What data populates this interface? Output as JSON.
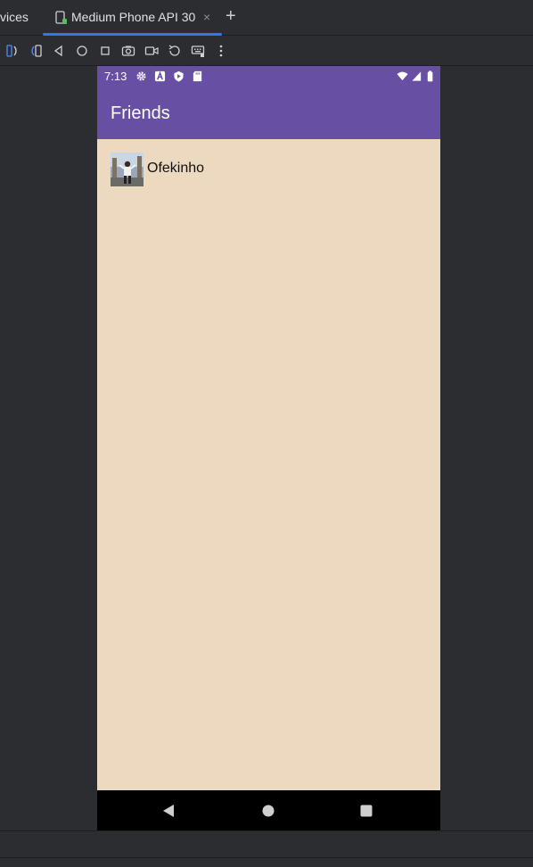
{
  "ide": {
    "prev_tab_label": "vices",
    "active_tab_label": "Medium Phone API 30",
    "close_glyph": "×",
    "add_glyph": "+",
    "accent": "#3574f0",
    "toolbar_icons": [
      "fold-icon",
      "unfold-icon",
      "back-icon",
      "home-icon",
      "overview-icon",
      "screenshot-icon",
      "screen-record-icon",
      "rotate-icon",
      "keyboard-icon",
      "more-icon"
    ]
  },
  "phone": {
    "status_time": "7:13",
    "status_icons_left": [
      "gear-icon",
      "a-badge-icon",
      "shield-icon",
      "sd-card-icon"
    ],
    "status_icons_right": [
      "wifi-icon",
      "signal-icon",
      "battery-icon"
    ],
    "app_title": "Friends",
    "app_bar_color": "#6750a4",
    "background_color": "#ecd9c0",
    "friends": [
      {
        "name": "Ofekinho",
        "avatar": "avatar"
      }
    ],
    "nav_buttons": [
      "back-icon",
      "home-icon",
      "recents-icon"
    ]
  }
}
